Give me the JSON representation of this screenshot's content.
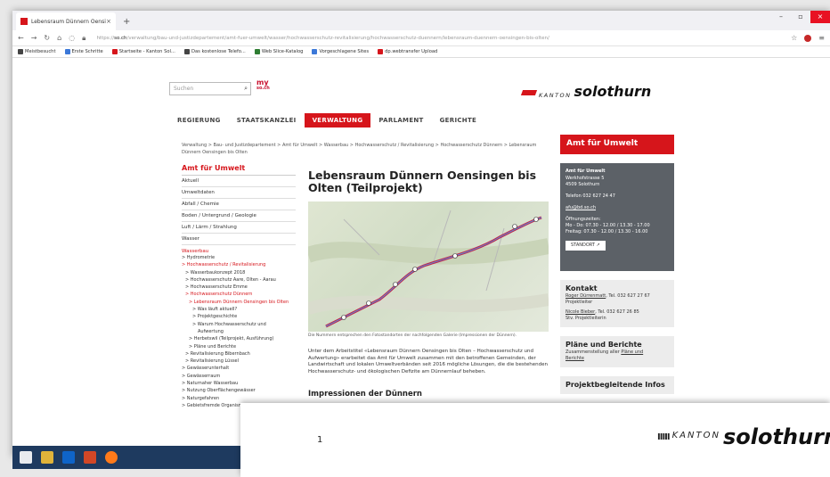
{
  "browser": {
    "tab_title": "Lebensraum Dünnern Oensing...",
    "tab_close": "×",
    "new_tab": "+",
    "win_min": "–",
    "win_max": "▫",
    "win_close": "×",
    "url_prefix": "https://",
    "url_domain": "so.ch",
    "url_path": "/verwaltung/bau-und-justizdepartement/amt-fuer-umwelt/wasser/hochwasserschutz-revitalisierung/hochwasserschutz-duennern/lebensraum-duennern-oensingen-bis-olten/",
    "bookmarks": [
      "Meistbesucht",
      "Erste Schritte",
      "Startseite - Kanton Sol...",
      "Das kostenlose Telefo...",
      "Web Slice-Katalog",
      "Vorgeschlagene Sites",
      "dp.webtransfer Upload"
    ]
  },
  "header": {
    "search_placeholder": "Suchen",
    "my_logo_top": "my",
    "my_logo_bottom": "so.ch",
    "kanton": "KANTON",
    "solothurn": "solothurn"
  },
  "nav": [
    "REGIERUNG",
    "STAATSKANZLEI",
    "VERWALTUNG",
    "PARLAMENT",
    "GERICHTE"
  ],
  "breadcrumb": "Verwaltung > Bau- und Justizdepartement > Amt für Umwelt > Wasserbau > Hochwasserschutz / Revitalisierung > Hochwasserschutz Dünnern > Lebensraum Dünnern Oensingen bis Olten",
  "sidebar": {
    "heading": "Amt für Umwelt",
    "items": [
      "Aktuell",
      "Umweltdaten",
      "Abfall / Chemie",
      "Boden / Untergrund / Geologie",
      "Luft / Lärm / Strahlung",
      "Wasser"
    ],
    "section": "Wasserbau",
    "subitems": [
      "> Hydrometrie",
      "> Hochwasserschutz / Revitalisierung",
      "> Wasserbaukonzept 2018",
      "> Hochwasserschutz Aare, Olten - Aarau",
      "> Hochwasserschutz Emme",
      "> Hochwasserschutz Dünnern",
      "> Lebensraum Dünnern Oensingen bis Olten",
      "> Was läuft aktuell?",
      "> Projektgeschichte",
      "> Warum Hochwasserschutz und",
      "Aufwertung",
      "> Herbetswil (Teilprojekt, Ausführung)",
      "> Pläne und Berichte",
      "> Revitalisierung Bibernbach",
      "> Revitalisierung Lüssel",
      "> Gewässerunterhalt",
      "> Gewässerraum",
      "> Naturnaher Wasserbau",
      "> Nutzung Oberflächengewässer",
      "> Naturgefahren",
      "> Gebietsfremde Organismen"
    ]
  },
  "content": {
    "title": "Lebensraum Dünnern Oensingen bis Olten (Teilprojekt)",
    "caption": "Die Nummern entsprechen den Fotostandorten der nachfolgenden Galerie (Impressionen der Dünnern).",
    "paragraph": "Unter dem Arbeitstitel «Lebensraum Dünnern Oensingen bis Olten – Hochwasserschutz und Aufwertung» erarbeitet das Amt für Umwelt zusammen mit den betroffenen Gemeinden, der Landwirtschaft und lokalen Umweltverbänden seit 2016 mögliche Lösungen, die die bestehenden Hochwasserschutz- und ökologischen Defizite am Dünnernlauf beheben.",
    "impressions": "Impressionen der Dünnern"
  },
  "right": {
    "header": "Amt für Umwelt",
    "box_title": "Amt für Umwelt",
    "address1": "Werkhofstrasse 5",
    "address2": "4509 Solothurn",
    "phone": "Telefon 032 627 24 47",
    "email": "afu@bd.so.ch",
    "hours_title": "Öffnungszeiten:",
    "hours1": "Mo - Do: 07.30 - 12.00 / 13.30 - 17.00",
    "hours2": "Freitag: 07.30 - 12.00 / 13.30 - 16.00",
    "standort": "STANDORT ↗",
    "kontakt_title": "Kontakt",
    "kontakt1_name": "Roger Dürrenmatt",
    "kontakt1_rest": ", Tel. 032 627 27 67",
    "kontakt1_role": "Projektleiter",
    "kontakt2_name": "Nicole Bieber",
    "kontakt2_rest": ", Tel. 032 627 26 85",
    "kontakt2_role": "Stv. Projektleiterin",
    "plaene_title": "Pläne und Berichte",
    "plaene_text": "Zusammenstellung aller ",
    "plaene_link1": "Pläne und",
    "plaene_link2": "Berichte",
    "projekt_title": "Projektbegleitende Infos"
  },
  "overlay": {
    "page_number": "1",
    "stripes": "IIIII",
    "kanton": "KANTON",
    "solothurn": "solothurn"
  }
}
